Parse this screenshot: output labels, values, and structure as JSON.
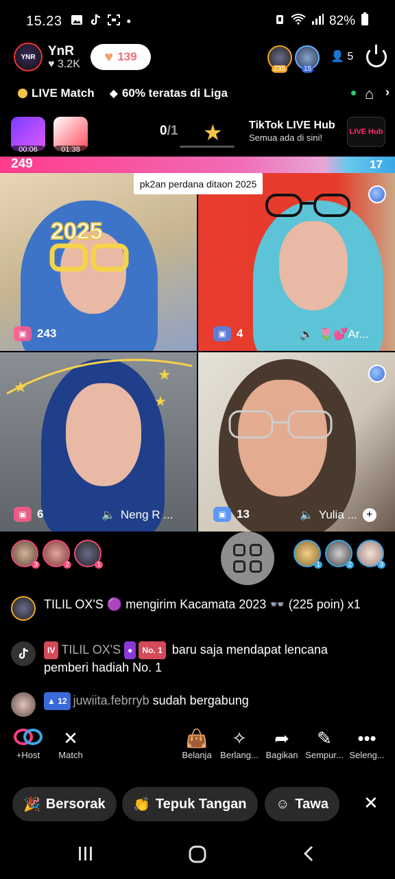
{
  "status": {
    "time": "15.23",
    "battery": "82%",
    "icons": [
      "gallery-icon",
      "tiktok-icon",
      "screenshot-icon",
      "dot-icon"
    ]
  },
  "header": {
    "host_avatar_text": "YNR",
    "host_name": "YnR",
    "host_likes": "♥ 3.2K",
    "likes_pill": "139",
    "top_gifter_1_badge": "235",
    "top_gifter_2_badge": "15",
    "viewer_count": "5"
  },
  "info": {
    "match_label": "LIVE Match",
    "league_label": "60% teratas di Liga"
  },
  "gifts": {
    "timer_1": "00:06",
    "timer_2": "01:38",
    "progress_current": "0",
    "progress_total": "/1",
    "hub_title": "TikTok LIVE Hub",
    "hub_subtitle": "Semua ada di sini!",
    "hub_logo": "LIVE Hub"
  },
  "score": {
    "left": "249",
    "right": "17"
  },
  "caption": "pk2an perdana ditaon 2025",
  "cells": [
    {
      "gift_count": "243",
      "name": ""
    },
    {
      "gift_count": "4",
      "name": "🌷💕Ar..."
    },
    {
      "gift_count": "6",
      "name": "Neng R ..."
    },
    {
      "gift_count": "13",
      "name": "Yulia ..."
    }
  ],
  "rankings": {
    "left": [
      "3",
      "2",
      "1"
    ],
    "right": [
      "1",
      "2",
      "3"
    ]
  },
  "chat": {
    "msg1_text": "TILIL OX'S 🟣 mengirim Kacamata 2023 👓  (225 poin) x1",
    "msg2_badge_level": "IV",
    "msg2_user": "TILIL OX'S",
    "msg2_badge_no": "No. 1",
    "msg2_text": "baru saja mendapat lencana pemberi hadiah No. 1",
    "msg3_level": "12",
    "msg3_user": "juwiita.febrryb",
    "msg3_text": "sudah bergabung"
  },
  "actions": [
    {
      "label": "+Host",
      "icon": "link-icon"
    },
    {
      "label": "Match",
      "icon": "match-icon"
    },
    {
      "label": "Belanja",
      "icon": "shopping-bag-icon"
    },
    {
      "label": "Berlang...",
      "icon": "subscribe-icon"
    },
    {
      "label": "Bagikan",
      "icon": "share-icon"
    },
    {
      "label": "Sempur...",
      "icon": "magic-wand-icon"
    },
    {
      "label": "Seleng...",
      "icon": "more-icon"
    }
  ],
  "chips": [
    {
      "label": "Bersorak",
      "icon": "cheer-icon"
    },
    {
      "label": "Tepuk Tangan",
      "icon": "clap-icon"
    },
    {
      "label": "Tawa",
      "icon": "laugh-icon"
    }
  ],
  "colors": {
    "accent_pink": "#ff3c8a",
    "accent_blue": "#3aa7e6"
  }
}
